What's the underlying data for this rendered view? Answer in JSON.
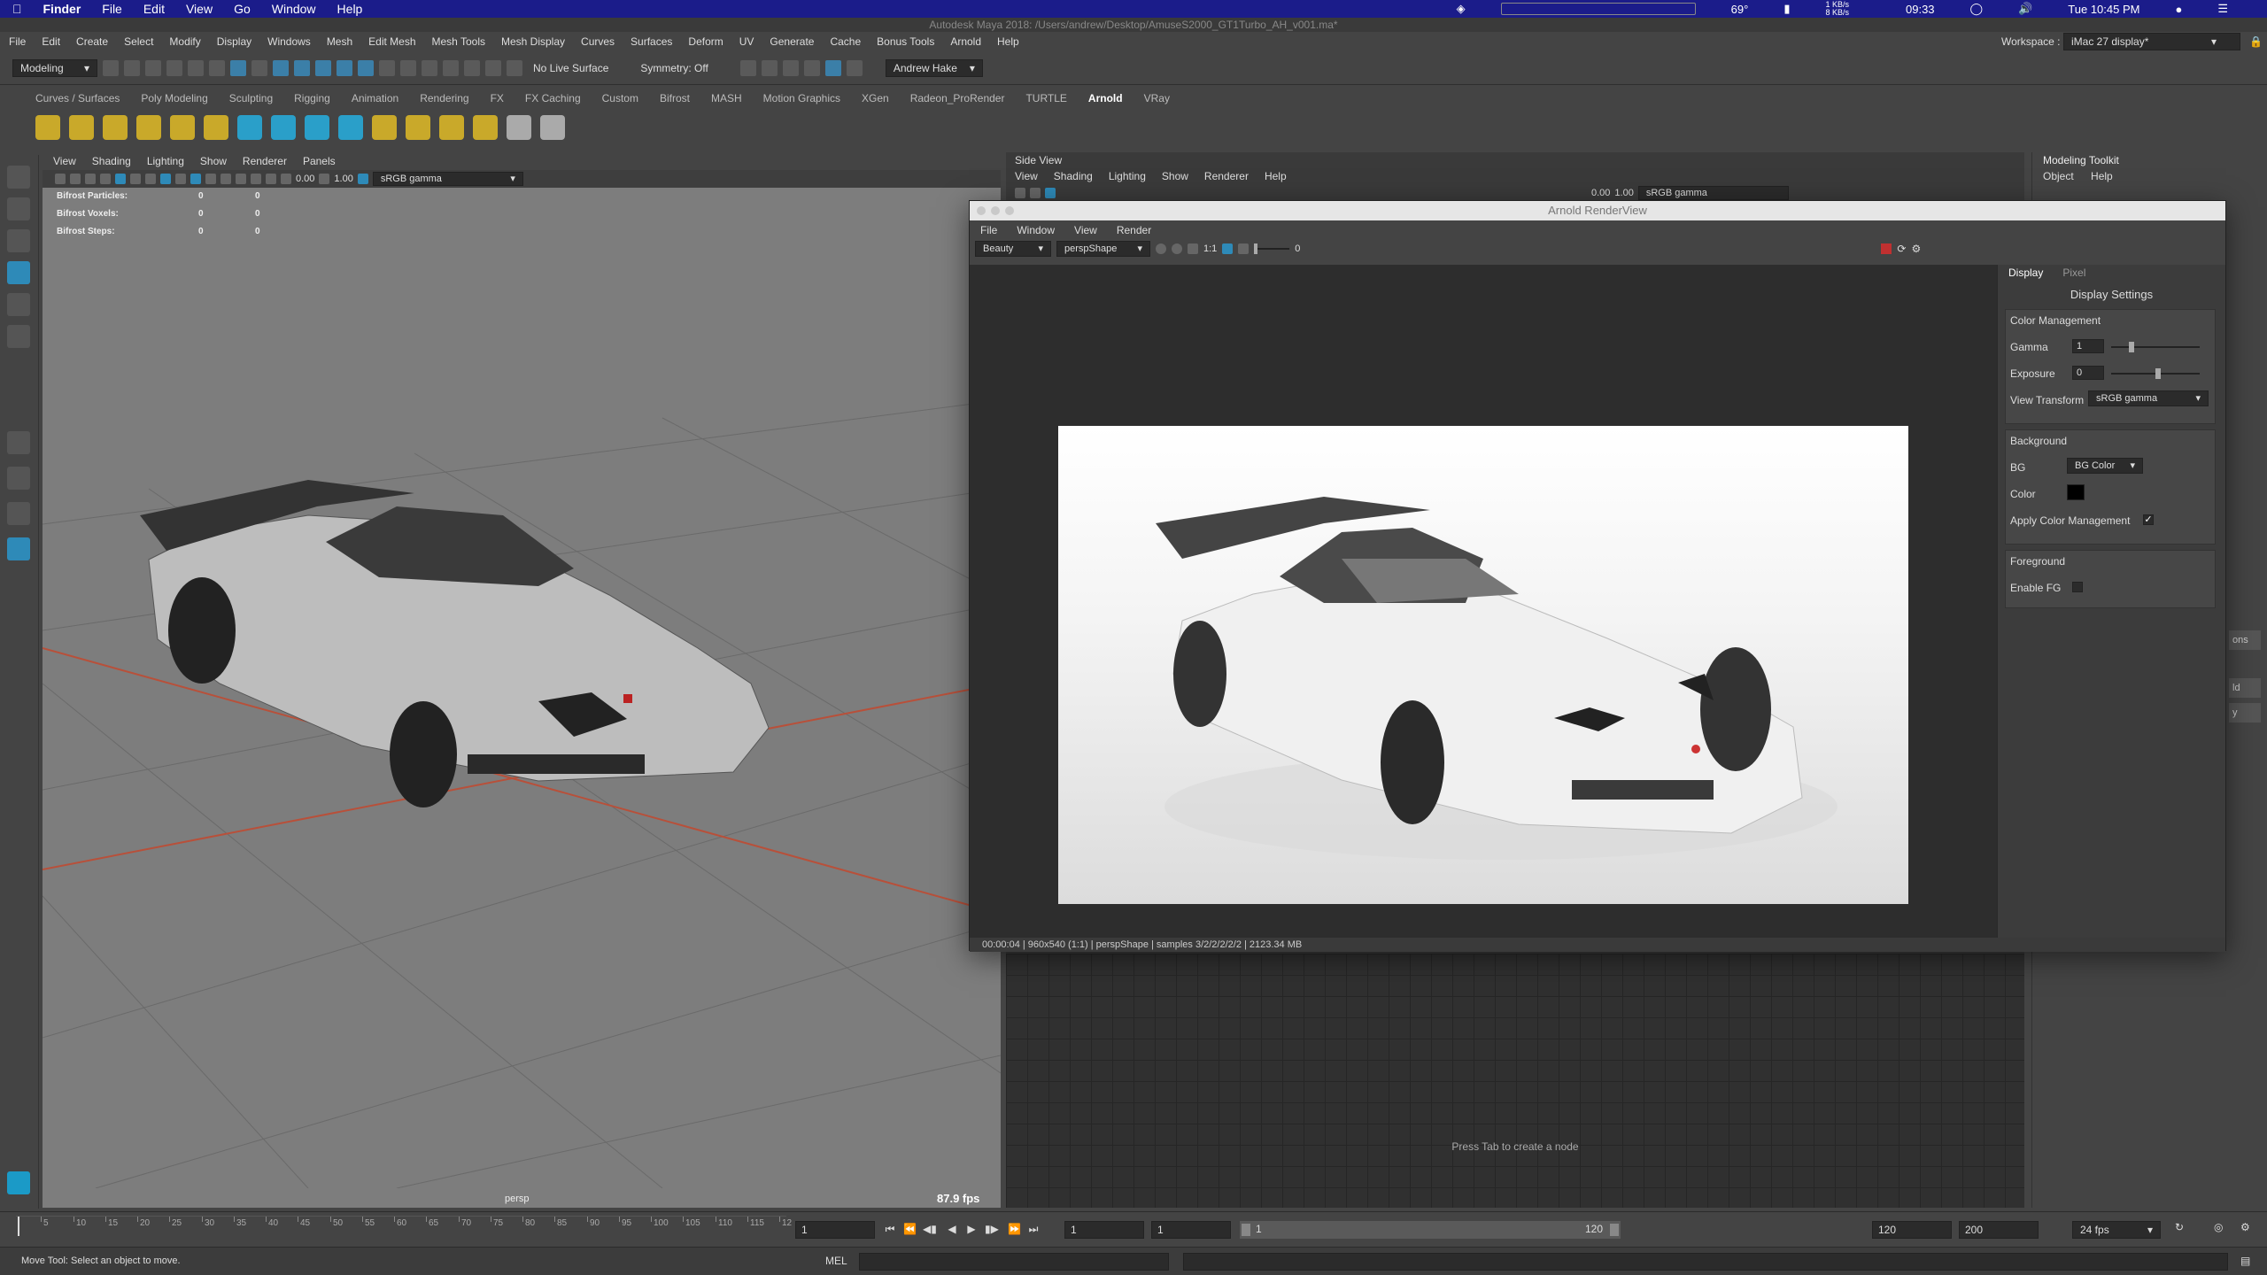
{
  "mac_menubar": {
    "app": "Finder",
    "items": [
      "File",
      "Edit",
      "View",
      "Go",
      "Window",
      "Help"
    ],
    "temperature": "69°",
    "net_up": "1 KB/s",
    "net_down": "8 KB/s",
    "timer": "09:33",
    "clock": "Tue 10:45 PM"
  },
  "window_title": "Autodesk Maya 2018: /Users/andrew/Desktop/AmuseS2000_GT1Turbo_AH_v001.ma*",
  "maya_menu": [
    "File",
    "Edit",
    "Create",
    "Select",
    "Modify",
    "Display",
    "Windows",
    "Mesh",
    "Edit Mesh",
    "Mesh Tools",
    "Mesh Display",
    "Curves",
    "Surfaces",
    "Deform",
    "UV",
    "Generate",
    "Cache",
    "Bonus Tools",
    "Arnold",
    "Help"
  ],
  "workspace": {
    "label": "Workspace :",
    "value": "iMac 27 display*"
  },
  "statusline": {
    "mode": "Modeling",
    "live_surface": "No Live Surface",
    "symmetry": "Symmetry: Off",
    "user": "Andrew Hake"
  },
  "shelf_tabs": [
    "Curves / Surfaces",
    "Poly Modeling",
    "Sculpting",
    "Rigging",
    "Animation",
    "Rendering",
    "FX",
    "FX Caching",
    "Custom",
    "Bifrost",
    "MASH",
    "Motion Graphics",
    "XGen",
    "Radeon_ProRender",
    "TURTLE",
    "Arnold",
    "VRay"
  ],
  "shelf_active": "Arnold",
  "persp_panel": {
    "menu": [
      "View",
      "Shading",
      "Lighting",
      "Show",
      "Renderer",
      "Panels"
    ],
    "toolbar_values": {
      "v1": "0.00",
      "v2": "1.00",
      "colorspace": "sRGB gamma"
    },
    "hud": [
      {
        "label": "Bifrost Particles:",
        "a": "0",
        "b": "0"
      },
      {
        "label": "Bifrost Voxels:",
        "a": "0",
        "b": "0"
      },
      {
        "label": "Bifrost Steps:",
        "a": "0",
        "b": "0"
      }
    ],
    "camera": "persp",
    "fps": "87.9 fps"
  },
  "side_panel": {
    "title": "Side View",
    "menu": [
      "View",
      "Shading",
      "Lighting",
      "Show",
      "Renderer",
      "Help"
    ],
    "toolbar_values": {
      "v1": "0.00",
      "v2": "1.00",
      "colorspace": "sRGB gamma"
    },
    "node_hint": "Press Tab to create a node"
  },
  "modeling_toolkit": {
    "title": "Modeling Toolkit",
    "menu": [
      "Object",
      "Help"
    ],
    "edge_labels": [
      "ons",
      "ld",
      "y"
    ]
  },
  "arnold_renderview": {
    "title": "Arnold RenderView",
    "menu": [
      "File",
      "Window",
      "View",
      "Render"
    ],
    "aov": "Beauty",
    "camera": "perspShape",
    "ratio": "1:1",
    "exposure_value": "0",
    "side_tabs": [
      "Display",
      "Pixel"
    ],
    "display_settings": "Display Settings",
    "color_management": "Color Management",
    "gamma_label": "Gamma",
    "gamma_value": "1",
    "exposure_label": "Exposure",
    "exposure_field": "0",
    "view_transform_label": "View Transform",
    "view_transform": "sRGB gamma",
    "background_label": "Background",
    "bg_label": "BG",
    "bg_value": "BG Color",
    "color_label": "Color",
    "apply_cm_label": "Apply Color Management",
    "apply_cm_check": "✓",
    "foreground_label": "Foreground",
    "enable_fg_label": "Enable FG",
    "status": "00:00:04 | 960x540 (1:1) | perspShape  | samples 3/2/2/2/2/2 | 2123.34 MB"
  },
  "timeline": {
    "ticks": [
      "5",
      "10",
      "15",
      "20",
      "25",
      "30",
      "35",
      "40",
      "45",
      "50",
      "55",
      "60",
      "65",
      "70",
      "75",
      "80",
      "85",
      "90",
      "95",
      "100",
      "105",
      "110",
      "115",
      "12"
    ],
    "current_frame": "1",
    "start": "1",
    "start2": "1",
    "range_start": "1",
    "range_end": "120",
    "end": "120",
    "end2": "200",
    "fps": "24 fps"
  },
  "helpline": {
    "text": "Move Tool: Select an object to move.",
    "mel": "MEL"
  },
  "colors": {
    "accent": "#2e8ab8",
    "mac_menubar": "#1b1c8a",
    "viewport_bg": "#7d7d7d",
    "render_bg": "#2d2d2d"
  }
}
